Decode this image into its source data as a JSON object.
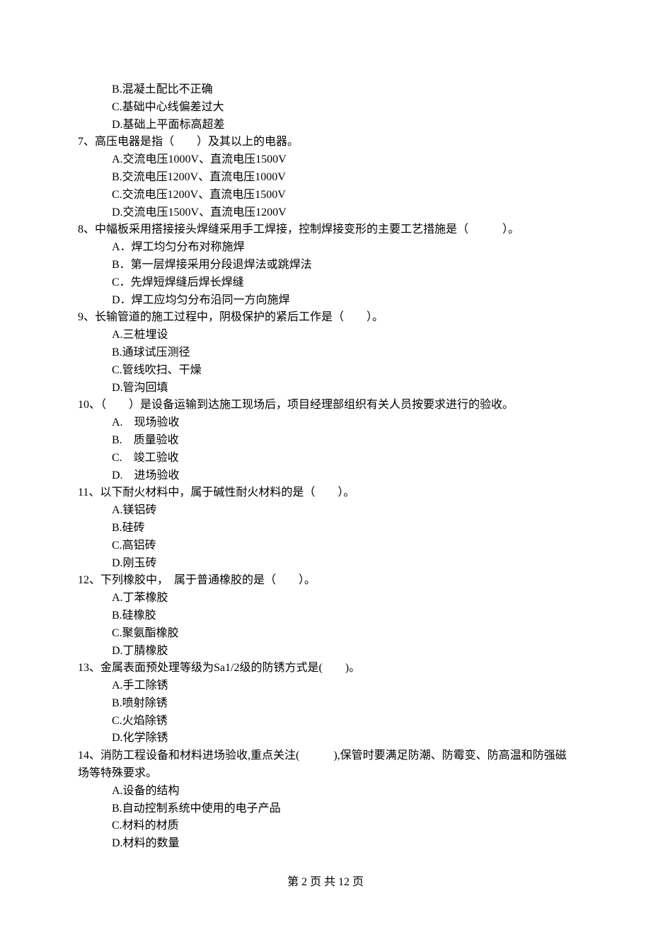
{
  "carryover_options": [
    "B.混凝土配比不正确",
    "C.基础中心线偏差过大",
    "D.基础上平面标高超差"
  ],
  "questions": [
    {
      "stem": "7、高压电器是指（　　）及其以上的电器。",
      "options": [
        "A.交流电压1000V、直流电压1500V",
        "B.交流电压1200V、直流电压1000V",
        "C.交流电压1200V、直流电压1500V",
        "D.交流电压1500V、直流电压1200V"
      ]
    },
    {
      "stem": "8、中幅板采用搭接接头焊缝采用手工焊接，控制焊接变形的主要工艺措施是（　　　）。",
      "options": [
        "A．焊工均匀分布对称施焊",
        "B．第一层焊接采用分段退焊法或跳焊法",
        "C．先焊短焊缝后焊长焊缝",
        "D．焊工应均匀分布沿同一方向施焊"
      ]
    },
    {
      "stem": "9、长输管道的施工过程中，阴极保护的紧后工作是（　　）。",
      "options": [
        "A.三桩埋设",
        "B.通球试压测径",
        "C.管线吹扫、干燥",
        "D.管沟回填"
      ]
    },
    {
      "stem": "10、（　　）是设备运输到达施工现场后，项目经理部组织有关人员按要求进行的验收。",
      "options": [
        "A.　现场验收",
        "B.　质量验收",
        "C.　竣工验收",
        "D.　进场验收"
      ]
    },
    {
      "stem": "11、以下耐火材料中，属于碱性耐火材料的是（　　）。",
      "options": [
        "A.镁铝砖",
        "B.硅砖",
        "C.高铝砖",
        "D.刚玉砖"
      ]
    },
    {
      "stem": "12、下列橡胶中，　属于普通橡胶的是（　　）。",
      "options": [
        "A.丁苯橡胶",
        "B.硅橡胶",
        "C.聚氨酯橡胶",
        "D.丁腈橡胶"
      ]
    },
    {
      "stem": "13、金属表面预处理等级为Sa1/2级的防锈方式是(　　)。",
      "options": [
        "A.手工除锈",
        "B.喷射除锈",
        "C.火焰除锈",
        "D.化学除锈"
      ]
    },
    {
      "stem": "14、消防工程设备和材料进场验收,重点关注(　　　),保管时要满足防潮、防霉变、防高温和防强磁场等特殊要求。",
      "options": [
        "A.设备的结构",
        "B.自动控制系统中使用的电子产品",
        "C.材料的材质",
        "D.材料的数量"
      ]
    }
  ],
  "pager": "第 2 页 共 12 页"
}
